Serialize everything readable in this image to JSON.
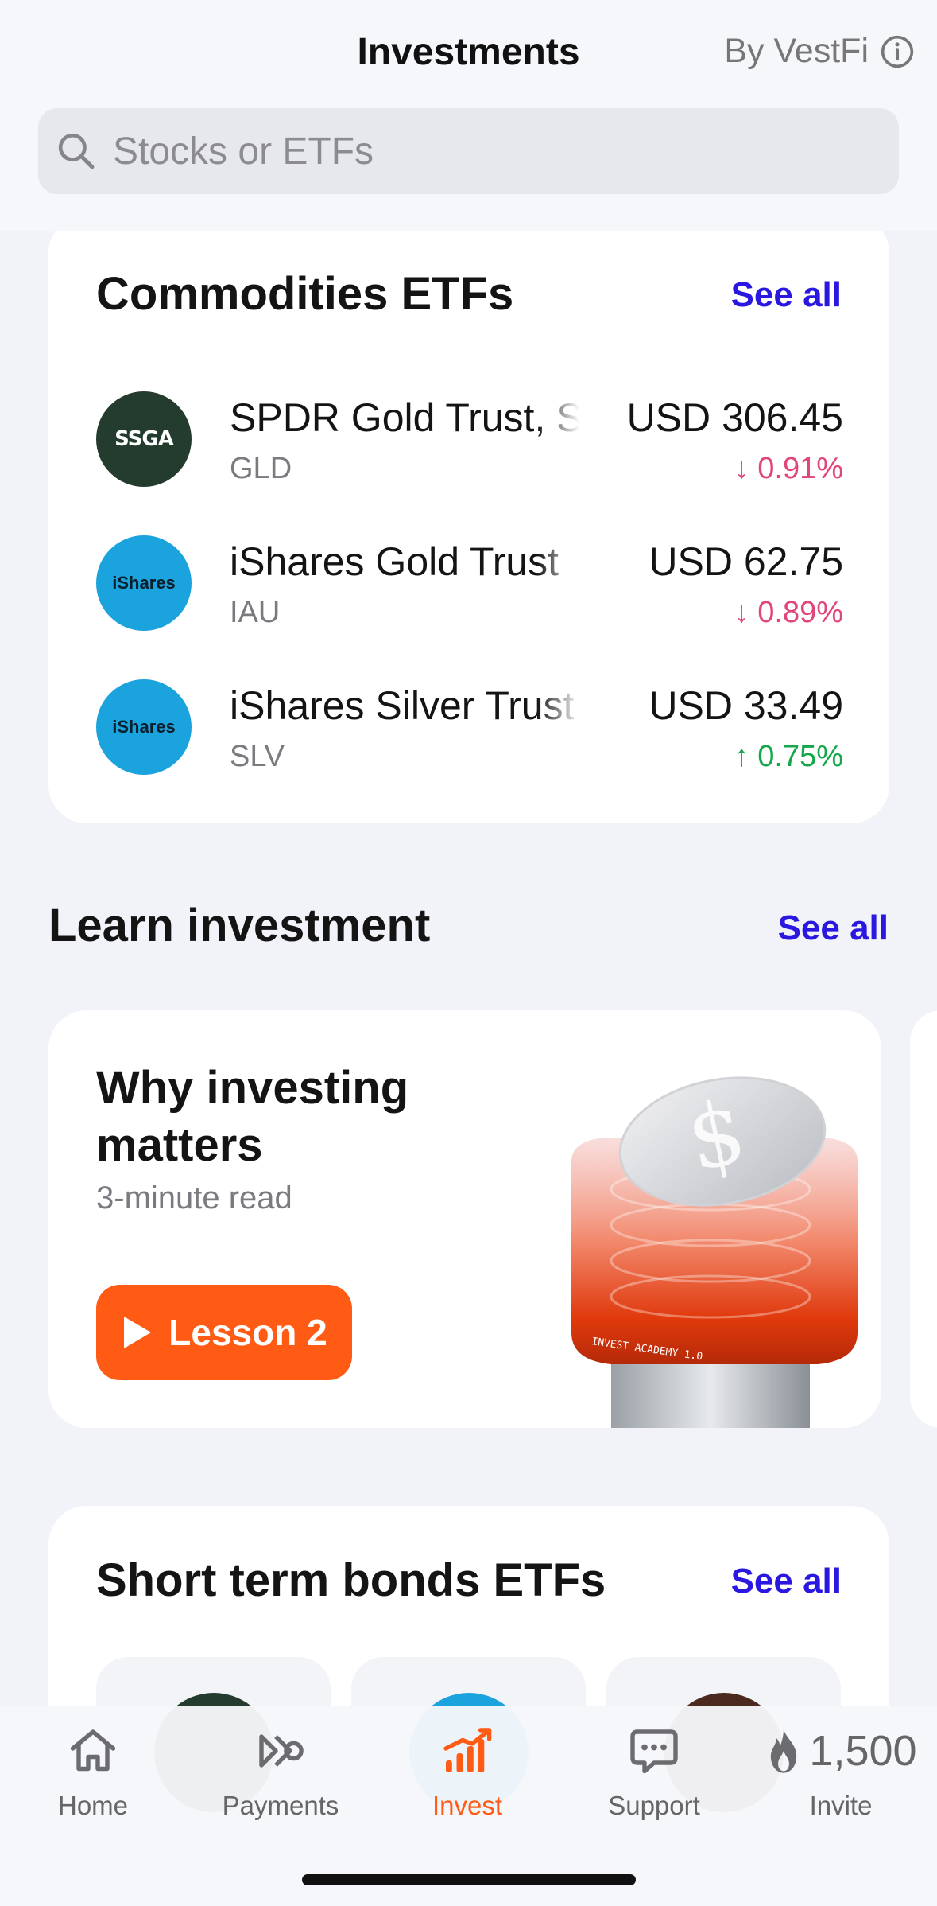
{
  "header": {
    "title": "Investments",
    "by_label": "By VestFi",
    "icons": {
      "info": "info-icon",
      "search": "search-icon"
    }
  },
  "search": {
    "placeholder": "Stocks or ETFs"
  },
  "commodities": {
    "title": "Commodities ETFs",
    "see_all": "See all",
    "items": [
      {
        "logo_text": "SSGA",
        "name": "SPDR Gold Trust, SPDR",
        "ticker": "GLD",
        "currency": "USD",
        "price": "306.45",
        "change": "0.91%",
        "direction": "down",
        "logo_color": "#243c2e"
      },
      {
        "logo_text": "iShares",
        "name": "iShares Gold Trust",
        "ticker": "IAU",
        "currency": "USD",
        "price": "62.75",
        "change": "0.89%",
        "direction": "down",
        "logo_color": "#1aa3dc"
      },
      {
        "logo_text": "iShares",
        "name": "iShares Silver Trust",
        "ticker": "SLV",
        "currency": "USD",
        "price": "33.49",
        "change": "0.75%",
        "direction": "up",
        "logo_color": "#1aa3dc"
      }
    ]
  },
  "learn": {
    "title": "Learn investment",
    "see_all": "See all",
    "card": {
      "title": "Why investing matters",
      "subtitle": "3-minute read",
      "button": "Lesson 2",
      "illustration_text": "INVEST ACADEMY 1.0"
    }
  },
  "bonds": {
    "title": "Short term bonds ETFs",
    "see_all": "See all",
    "logo_colors": [
      "#243c2e",
      "#1aa3dc",
      "#4a2a1e"
    ]
  },
  "tabbar": {
    "tabs": [
      {
        "label": "Home",
        "icon": "home-icon"
      },
      {
        "label": "Payments",
        "icon": "payments-icon"
      },
      {
        "label": "Invest",
        "icon": "invest-icon"
      },
      {
        "label": "Support",
        "icon": "support-icon"
      },
      {
        "label": "Invite",
        "icon": "flame-icon",
        "count": "1,500"
      }
    ],
    "active": "Invest"
  },
  "colors": {
    "accent": "#ff5b15",
    "link": "#2a18e0",
    "negative": "#e0457b",
    "positive": "#14a84a"
  }
}
